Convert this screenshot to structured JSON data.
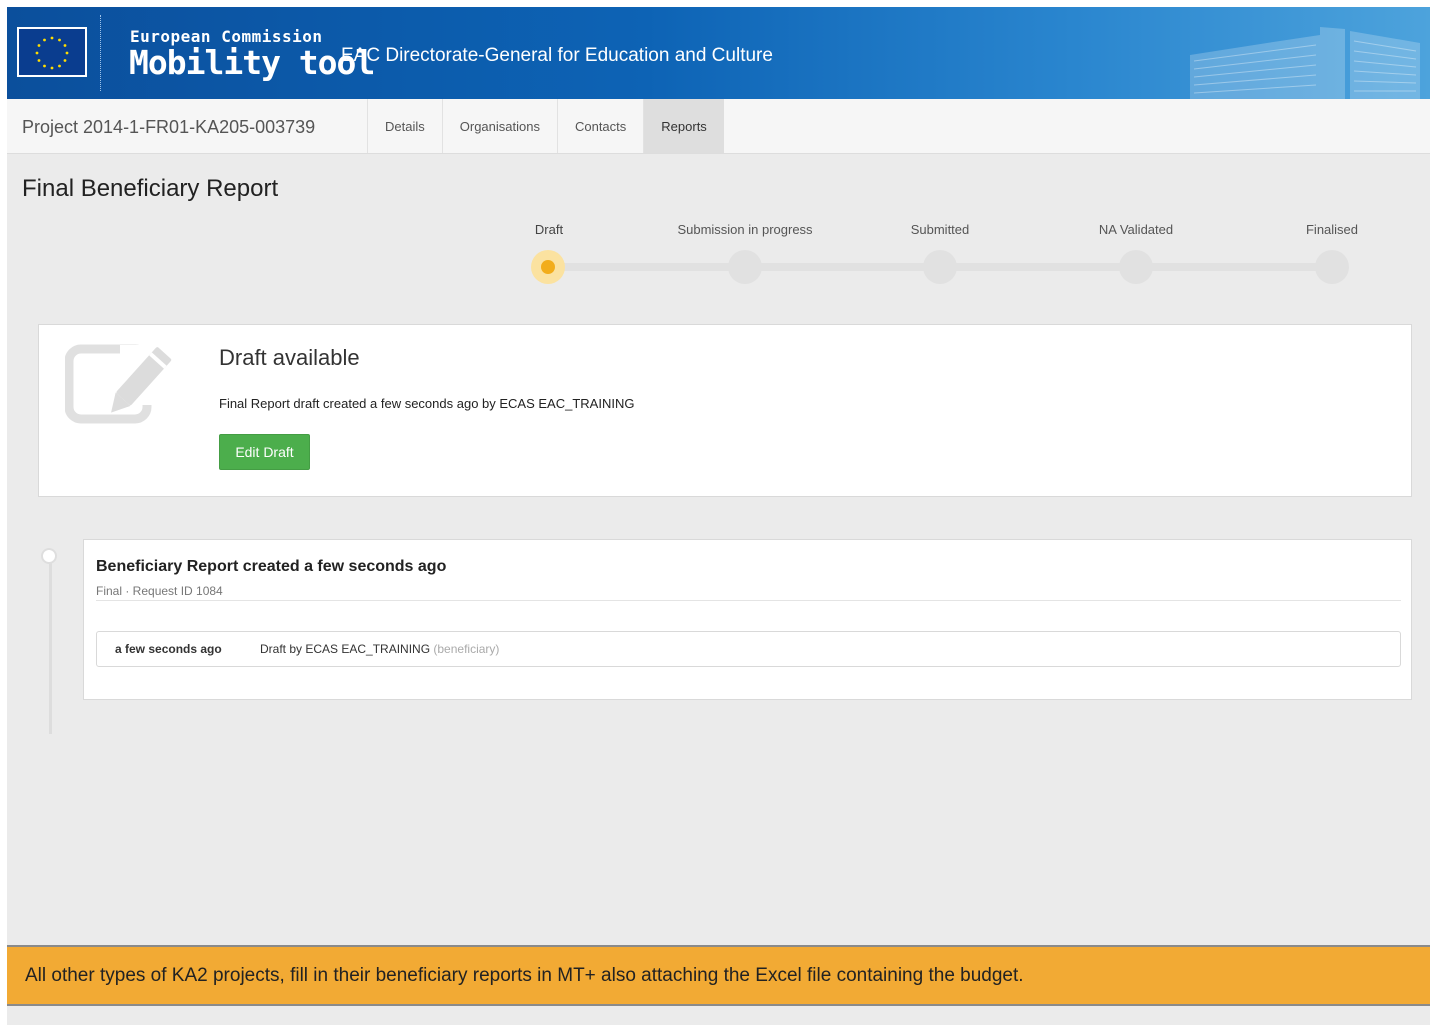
{
  "header": {
    "ec_title": "European Commission",
    "app_title": "Mobility tool",
    "dg_title": "EAC Directorate-General for Education and Culture"
  },
  "project": {
    "title": "Project 2014-1-FR01-KA205-003739",
    "tabs": [
      {
        "label": "Details",
        "active": false
      },
      {
        "label": "Organisations",
        "active": false
      },
      {
        "label": "Contacts",
        "active": false
      },
      {
        "label": "Reports",
        "active": true
      }
    ]
  },
  "page": {
    "title": "Final Beneficiary Report"
  },
  "progress": {
    "steps": [
      "Draft",
      "Submission in progress",
      "Submitted",
      "NA Validated",
      "Finalised"
    ],
    "current_step": "Draft"
  },
  "draft_panel": {
    "icon": "edit-icon",
    "title": "Draft available",
    "message": "Final Report draft created a few seconds ago by ECAS EAC_TRAINING",
    "button_label": "Edit Draft"
  },
  "timeline": {
    "event_title": "Beneficiary Report created a few seconds ago",
    "event_sub": "Final · Request ID 1084",
    "entries": [
      {
        "time": "a few seconds ago",
        "description": "Draft by ECAS EAC_TRAINING",
        "role": "(beneficiary)"
      }
    ]
  },
  "notice": {
    "text": "All other types of KA2 projects, fill in their beneficiary reports in MT+ also attaching the Excel file containing the budget."
  },
  "colors": {
    "header_blue": "#0d5fae",
    "current_step": "#f2ad1b",
    "button_green": "#4cae4c",
    "notice_orange": "#f2aa34"
  }
}
